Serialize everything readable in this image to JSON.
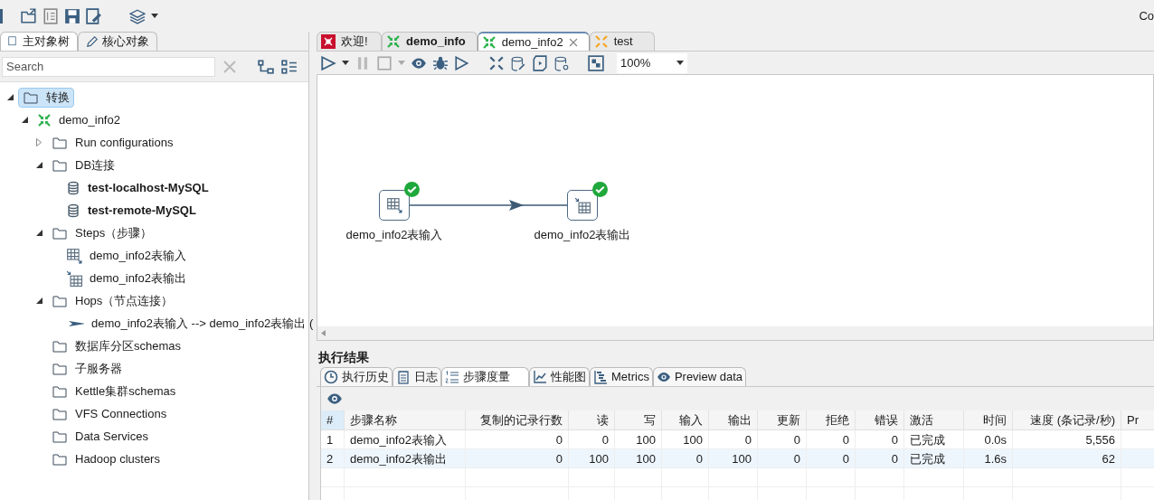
{
  "top_toolbar": {
    "right_text": "Co"
  },
  "left_tabs": [
    {
      "label": "主对象树",
      "selected": true
    },
    {
      "label": "核心对象",
      "selected": false
    }
  ],
  "search": {
    "placeholder": "Search"
  },
  "tree": [
    {
      "label": "转换",
      "kind": "folder",
      "expanded": true,
      "selected": true,
      "children": [
        {
          "label": "demo_info2",
          "kind": "trans",
          "expanded": true,
          "selected": false,
          "children": [
            {
              "label": "Run configurations",
              "kind": "folder",
              "expanded": false,
              "selected": false
            },
            {
              "label": "DB连接",
              "kind": "folder",
              "expanded": true,
              "selected": false,
              "children": [
                {
                  "label": "test-localhost-MySQL",
                  "kind": "db",
                  "bold": true,
                  "selected": false
                },
                {
                  "label": "test-remote-MySQL",
                  "kind": "db",
                  "bold": true,
                  "selected": false
                }
              ]
            },
            {
              "label": "Steps（步骤）",
              "kind": "folder",
              "expanded": true,
              "selected": false,
              "children": [
                {
                  "label": "demo_info2表输入",
                  "kind": "step_in",
                  "selected": false
                },
                {
                  "label": "demo_info2表输出",
                  "kind": "step_out",
                  "selected": false
                }
              ]
            },
            {
              "label": "Hops（节点连接）",
              "kind": "folder",
              "expanded": true,
              "selected": false,
              "children": [
                {
                  "label": "demo_info2表输入 --> demo_info2表输出 (",
                  "kind": "hop",
                  "selected": false
                }
              ]
            },
            {
              "label": "数据库分区schemas",
              "kind": "folder",
              "selected": false
            },
            {
              "label": "子服务器",
              "kind": "folder",
              "selected": false
            },
            {
              "label": "Kettle集群schemas",
              "kind": "folder",
              "selected": false
            },
            {
              "label": "VFS Connections",
              "kind": "folder",
              "selected": false
            },
            {
              "label": "Data Services",
              "kind": "folder",
              "selected": false
            },
            {
              "label": "Hadoop clusters",
              "kind": "folder",
              "selected": false
            }
          ]
        }
      ]
    }
  ],
  "editor_tabs": [
    {
      "label": "欢迎!",
      "kind": "welcome",
      "bold": false,
      "closable": false,
      "selected": false
    },
    {
      "label": "demo_info",
      "kind": "trans",
      "bold": true,
      "closable": false,
      "selected": false
    },
    {
      "label": "demo_info2",
      "kind": "trans",
      "bold": false,
      "closable": true,
      "selected": true
    },
    {
      "label": "test",
      "kind": "job",
      "bold": false,
      "closable": false,
      "selected": false
    }
  ],
  "zoom": {
    "value": "100%"
  },
  "canvas": {
    "steps": [
      {
        "label": "demo_info2表输入",
        "kind": "step_in",
        "done": true
      },
      {
        "label": "demo_info2表输出",
        "kind": "step_out",
        "done": true
      }
    ]
  },
  "results": {
    "title": "执行结果",
    "tabs": [
      {
        "label": "执行历史",
        "kind": "history",
        "selected": false
      },
      {
        "label": "日志",
        "kind": "log",
        "selected": false
      },
      {
        "label": "步骤度量",
        "kind": "metrics_list",
        "selected": true
      },
      {
        "label": "性能图",
        "kind": "chart",
        "selected": false
      },
      {
        "label": "Metrics",
        "kind": "gantt",
        "selected": false
      },
      {
        "label": "Preview data",
        "kind": "preview",
        "selected": false
      }
    ],
    "table": {
      "columns": [
        {
          "label": "#",
          "kind": "text"
        },
        {
          "label": "步骤名称",
          "kind": "text"
        },
        {
          "label": "复制的记录行数",
          "kind": "number"
        },
        {
          "label": "读",
          "kind": "number"
        },
        {
          "label": "写",
          "kind": "number"
        },
        {
          "label": "输入",
          "kind": "number"
        },
        {
          "label": "输出",
          "kind": "number"
        },
        {
          "label": "更新",
          "kind": "number"
        },
        {
          "label": "拒绝",
          "kind": "number"
        },
        {
          "label": "错误",
          "kind": "number"
        },
        {
          "label": "激活",
          "kind": "text"
        },
        {
          "label": "时间",
          "kind": "number"
        },
        {
          "label": "速度 (条记录/秒)",
          "kind": "number"
        },
        {
          "label": "Pr",
          "kind": "text"
        }
      ],
      "rows": [
        {
          "selected": false,
          "cells": [
            "1",
            "demo_info2表输入",
            "0",
            "0",
            "100",
            "100",
            "0",
            "0",
            "0",
            "0",
            "已完成",
            "0.0s",
            "5,556",
            ""
          ]
        },
        {
          "selected": true,
          "cells": [
            "2",
            "demo_info2表输出",
            "0",
            "100",
            "100",
            "0",
            "100",
            "0",
            "0",
            "0",
            "已完成",
            "1.6s",
            "62",
            ""
          ]
        }
      ]
    }
  }
}
